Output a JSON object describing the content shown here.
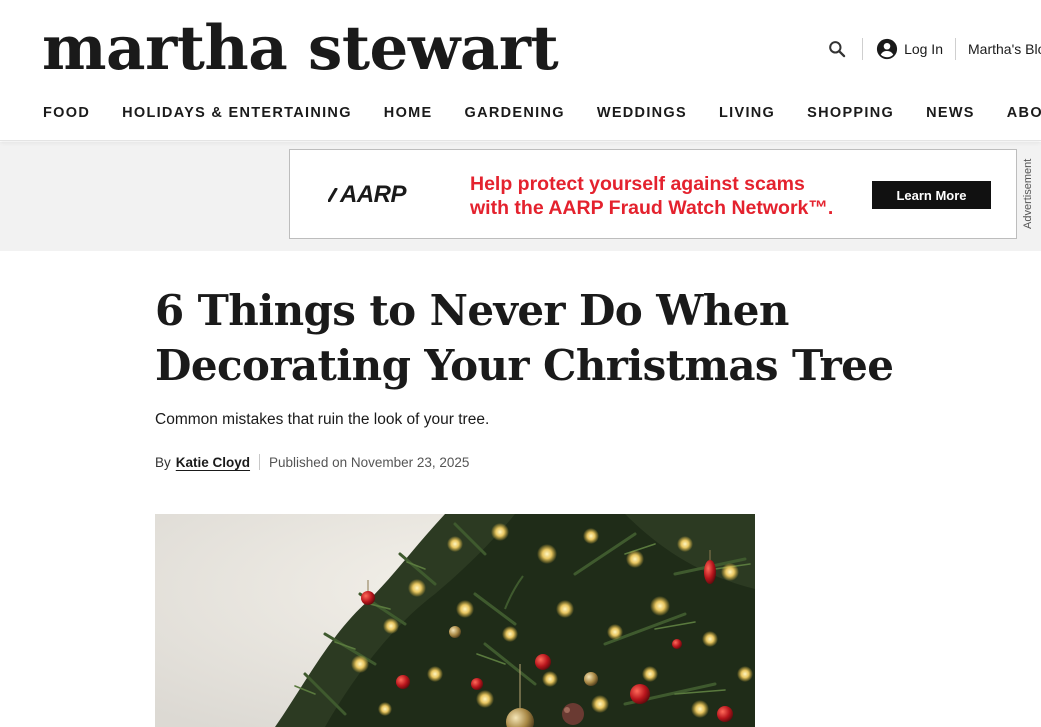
{
  "header": {
    "logo": "martha stewart",
    "search_icon": "search-icon",
    "account_icon": "account-circle-icon",
    "login_label": "Log In",
    "blog_label": "Martha's Blog"
  },
  "nav": {
    "items": [
      {
        "label": "FOOD"
      },
      {
        "label": "HOLIDAYS & ENTERTAINING"
      },
      {
        "label": "HOME"
      },
      {
        "label": "GARDENING"
      },
      {
        "label": "WEDDINGS"
      },
      {
        "label": "LIVING"
      },
      {
        "label": "SHOPPING"
      },
      {
        "label": "NEWS"
      },
      {
        "label": "ABOUT US"
      }
    ]
  },
  "ad": {
    "brand": "AARP",
    "headline_line1": "Help protect yourself against scams",
    "headline_line2": "with the AARP Fraud Watch Network™.",
    "cta": "Learn More",
    "label": "Advertisement",
    "headline_color": "#e4222e"
  },
  "article": {
    "title": "6 Things to Never Do When Decorating Your Christmas Tree",
    "subtitle": "Common mistakes that ruin the look of your tree.",
    "by": "By",
    "author": "Katie Cloyd",
    "published": "Published on November 23, 2025"
  }
}
